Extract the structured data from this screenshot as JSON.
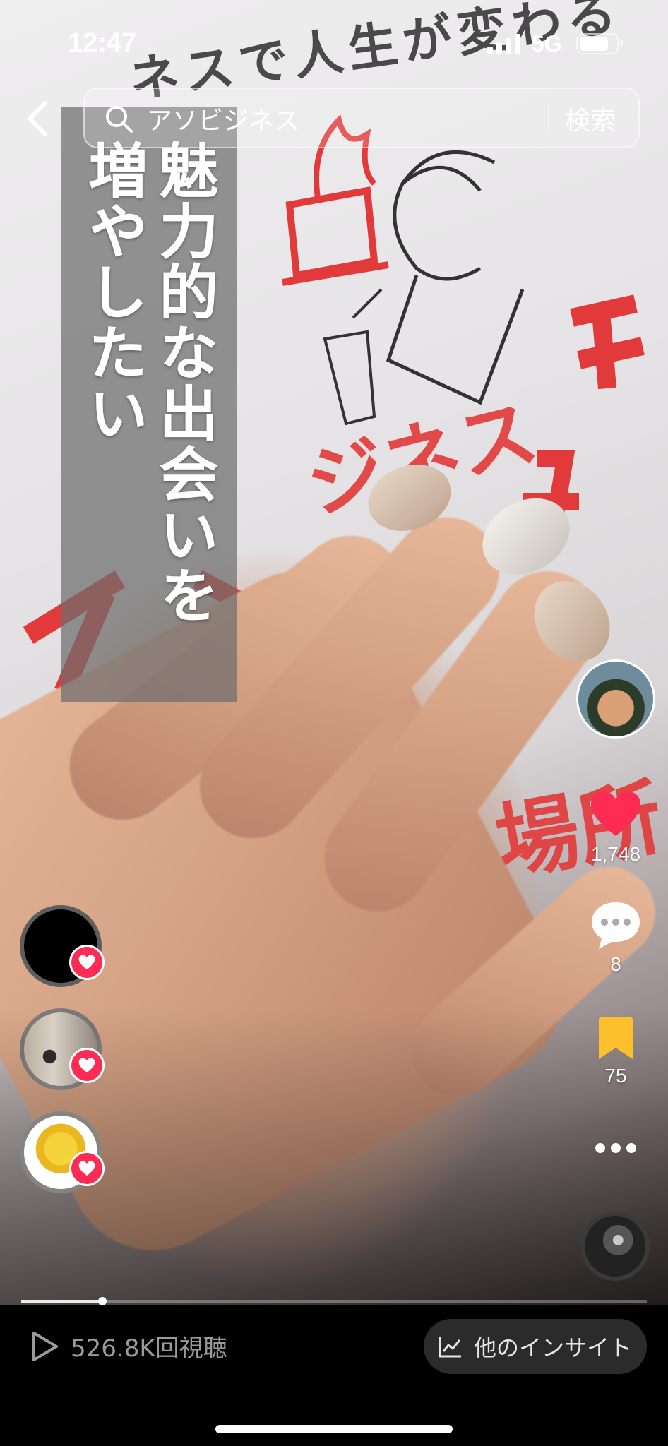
{
  "status_bar": {
    "time": "12:47",
    "network": "5G"
  },
  "search": {
    "query": "アソビジネス",
    "submit_label": "検索"
  },
  "caption": {
    "lines": [
      "魅力的な出会いを",
      "増やしたい"
    ]
  },
  "video_content": {
    "header_text": "ネスで人生が変わる",
    "title_fragment": "ジネス",
    "subtitle_fragment": "場所"
  },
  "actions": {
    "like_count": "1,748",
    "comment_count": "8",
    "bookmark_count": "75"
  },
  "progress": {
    "fraction": 0.13
  },
  "bottom_bar": {
    "views": "526.8K回視聴",
    "insight_label": "他のインサイト"
  },
  "colors": {
    "accent": "#fe2c55",
    "bookmark": "#fcc02c",
    "bottom_bar": "#000000",
    "insight_pill": "#2b2b2b"
  }
}
